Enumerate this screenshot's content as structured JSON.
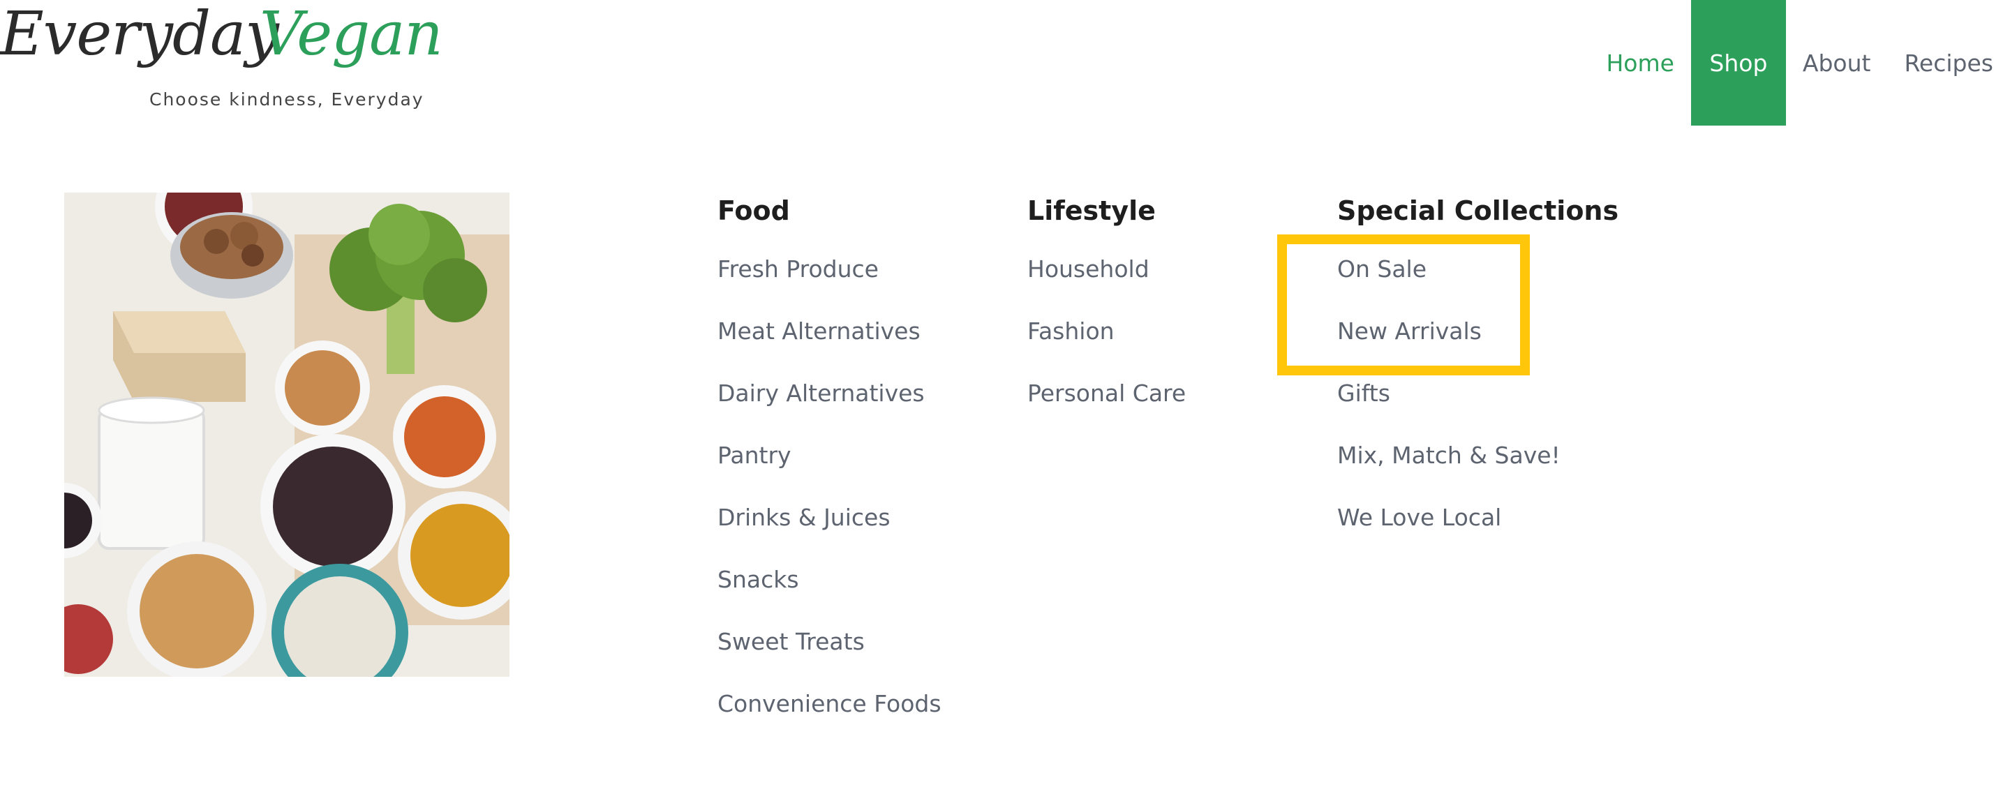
{
  "logo": {
    "word1": "Everyday",
    "word2": "Vegan",
    "tagline": "Choose kindness, Everyday"
  },
  "nav": {
    "items": [
      {
        "label": "Home"
      },
      {
        "label": "Shop"
      },
      {
        "label": "About"
      },
      {
        "label": "Recipes"
      }
    ],
    "active": "Shop"
  },
  "menu": {
    "columns": [
      {
        "heading": "Food",
        "items": [
          "Fresh Produce",
          "Meat Alternatives",
          "Dairy Alternatives",
          "Pantry",
          "Drinks & Juices",
          "Snacks",
          "Sweet Treats",
          "Convenience Foods"
        ]
      },
      {
        "heading": "Lifestyle",
        "items": [
          "Household",
          "Fashion",
          "Personal Care"
        ]
      },
      {
        "heading": "Special Collections",
        "items": [
          "On Sale",
          "New Arrivals",
          "Gifts",
          "Mix, Match & Save!",
          "We Love Local"
        ]
      }
    ]
  },
  "colors": {
    "brand_green": "#2ca05a",
    "highlight": "#ffc60a",
    "text_muted": "#5d6470",
    "heading": "#1e1e1e"
  }
}
